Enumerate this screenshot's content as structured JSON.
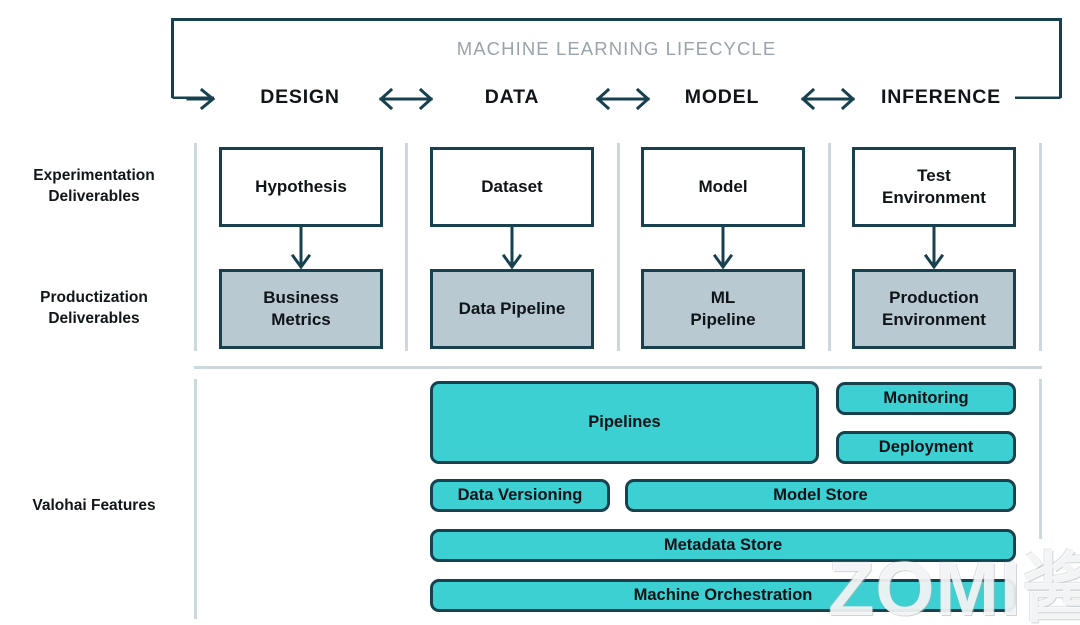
{
  "diagram": {
    "lifecycle": {
      "title": "MACHINE LEARNING LIFECYCLE",
      "stages": [
        {
          "label": "DESIGN"
        },
        {
          "label": "DATA"
        },
        {
          "label": "MODEL"
        },
        {
          "label": "INFERENCE"
        }
      ],
      "connector_icons": [
        "arrow-right-icon",
        "double-arrow-icon",
        "double-arrow-icon",
        "double-arrow-icon"
      ]
    },
    "row_labels": [
      {
        "id": "experimentation",
        "line1": "Experimentation",
        "line2": "Deliverables"
      },
      {
        "id": "productization",
        "line1": "Productization",
        "line2": "Deliverables"
      },
      {
        "id": "valohai",
        "line1": "Valohai Features",
        "line2": ""
      }
    ],
    "experimentation_deliverables": [
      {
        "label": "Hypothesis"
      },
      {
        "label": "Dataset"
      },
      {
        "label": "Model"
      },
      {
        "label": "Test\nEnvironment"
      }
    ],
    "productization_deliverables": [
      {
        "label": "Business\nMetrics"
      },
      {
        "label": "Data Pipeline"
      },
      {
        "label": "ML\nPipeline"
      },
      {
        "label": "Production\nEnvironment"
      }
    ],
    "valohai_features": [
      {
        "label": "Pipelines"
      },
      {
        "label": "Monitoring"
      },
      {
        "label": "Deployment"
      },
      {
        "label": "Data Versioning"
      },
      {
        "label": "Model Store"
      },
      {
        "label": "Metadata Store"
      },
      {
        "label": "Machine Orchestration"
      }
    ],
    "watermark": "ZOMI酱",
    "colors": {
      "teal_fill": "#3cd0d3",
      "dark_outline": "#17414f",
      "gray_fill": "#b9c9d2",
      "separator": "#ccd7de",
      "lifecycle_title": "#9aa3ac"
    }
  }
}
